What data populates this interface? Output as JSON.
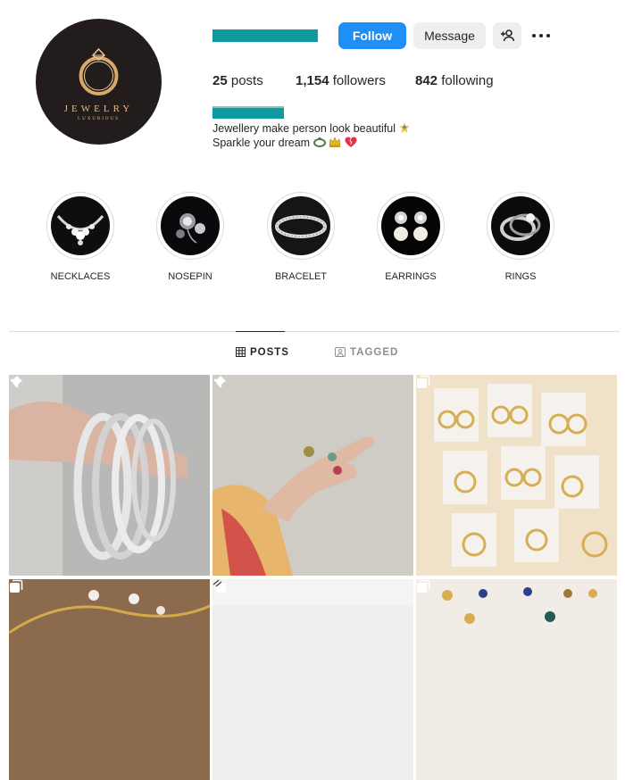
{
  "profile": {
    "avatar": {
      "brand": "JEWELRY",
      "tagline": "LUXURIOUS"
    },
    "actions": {
      "follow_label": "Follow",
      "message_label": "Message"
    },
    "stats": {
      "posts_count": "25",
      "posts_label": "posts",
      "followers_count": "1,154",
      "followers_label": "followers",
      "following_count": "842",
      "following_label": "following"
    },
    "bio": {
      "line1": "Jewellery make person look beautiful",
      "line2": "Sparkle your dream"
    }
  },
  "highlights": [
    {
      "label": "NECKLACES"
    },
    {
      "label": "NOSEPIN"
    },
    {
      "label": "BRACELET"
    },
    {
      "label": "EARRINGS"
    },
    {
      "label": "RINGS"
    }
  ],
  "tabs": [
    {
      "label": "POSTS",
      "active": true
    },
    {
      "label": "TAGGED",
      "active": false
    }
  ],
  "colors": {
    "accent": "#1e8ff5",
    "redacted": "#0e9a9e",
    "avatar_bg": "#221c1c",
    "gold": "#e2bd8a"
  }
}
